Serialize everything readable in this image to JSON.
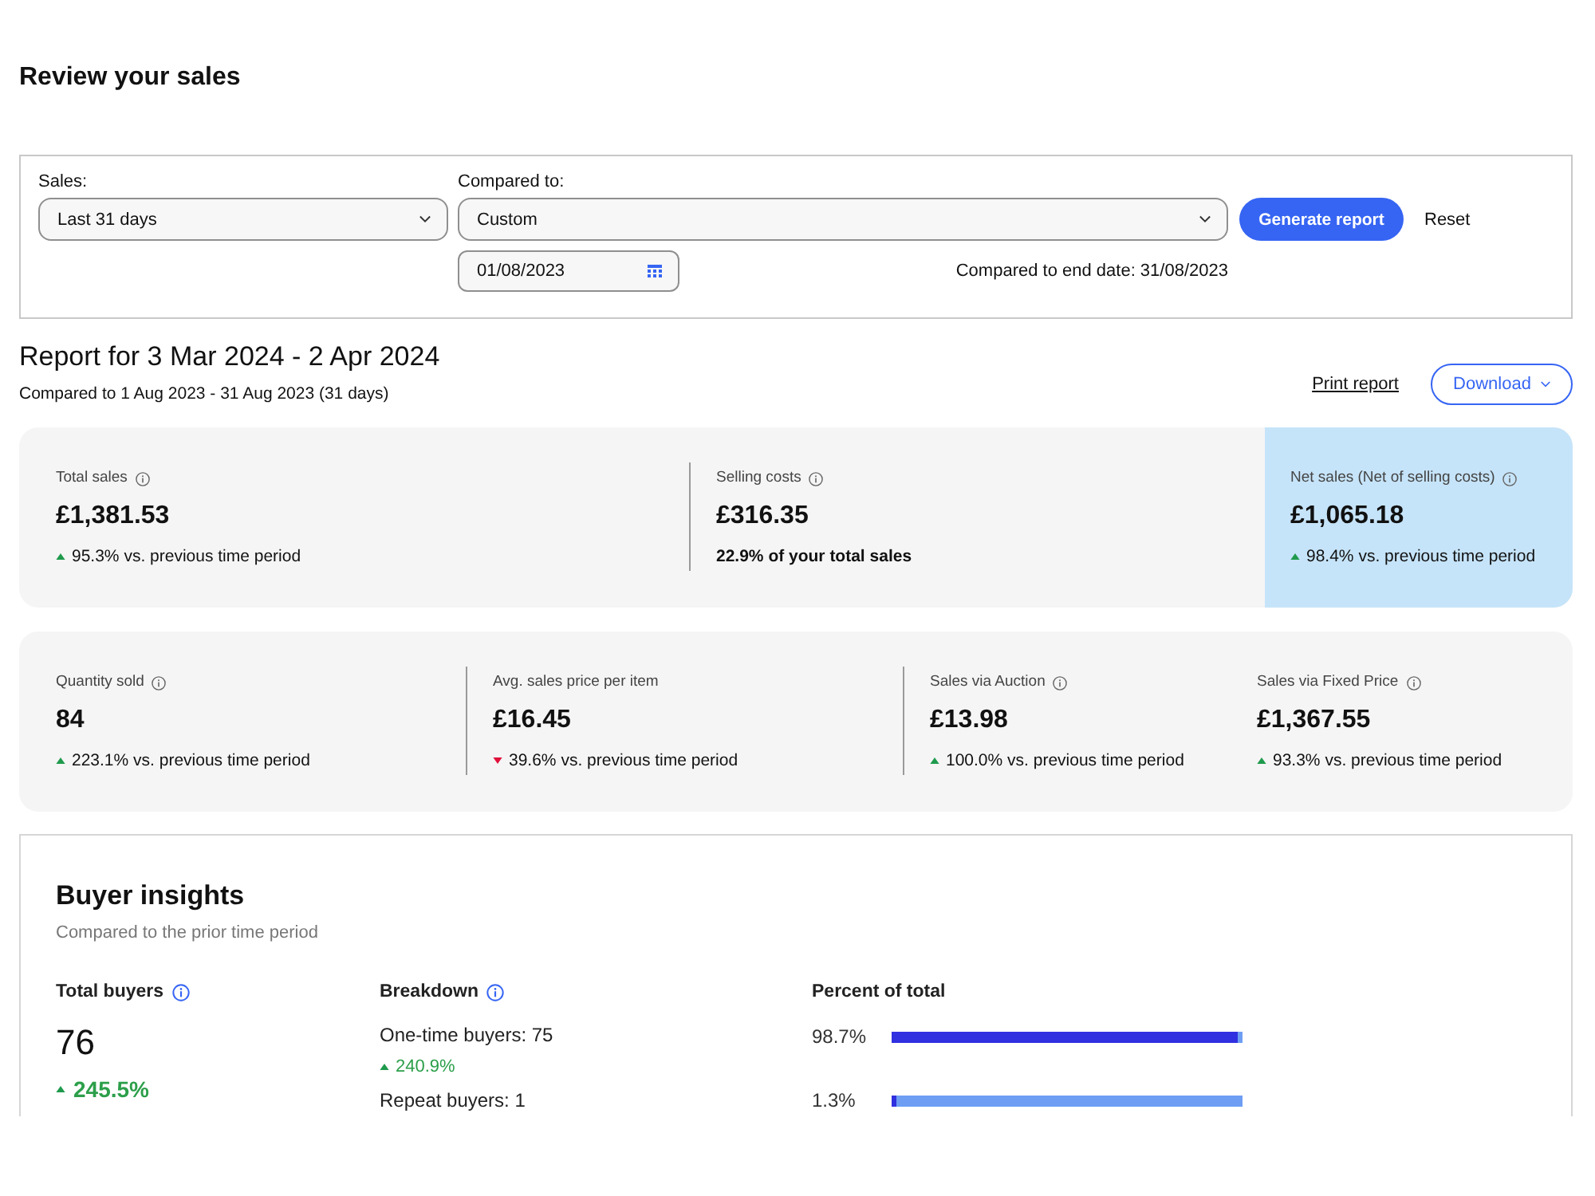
{
  "page": {
    "title": "Review your sales"
  },
  "filters": {
    "sales": {
      "label": "Sales:",
      "value": "Last 31 days"
    },
    "compared_to": {
      "label": "Compared to:",
      "value": "Custom"
    },
    "generate_button": "Generate report",
    "reset_button": "Reset",
    "start_date": {
      "value": "01/08/2023"
    },
    "end_date_note": "Compared to end date: 31/08/2023"
  },
  "report": {
    "title": "Report for 3 Mar 2024 - 2 Apr 2024",
    "subtitle": "Compared to 1 Aug 2023 - 31 Aug 2023 (31 days)",
    "print_link": "Print report",
    "download_button": "Download"
  },
  "summary_cards": [
    {
      "metrics": [
        {
          "label": "Total sales",
          "info": true,
          "highlighted": false,
          "value": "£1,381.53",
          "change": {
            "increase": true,
            "percent": "95.3%",
            "text": "vs. previous time period"
          }
        },
        {
          "label": "Selling costs",
          "info": true,
          "highlighted": false,
          "value": "£316.35",
          "note": "22.9% of your total sales"
        },
        {
          "label": "Net sales (Net of selling costs)",
          "info": true,
          "highlighted": true,
          "value": "£1,065.18",
          "change": {
            "increase": true,
            "percent": "98.4%",
            "text": "vs. previous time period"
          }
        }
      ]
    },
    {
      "metrics": [
        {
          "label": "Quantity sold",
          "info": true,
          "highlighted": false,
          "value": "84",
          "change": {
            "increase": true,
            "percent": "223.1%",
            "text": "vs. previous time period"
          }
        },
        {
          "label": "Avg. sales price per item",
          "info": false,
          "highlighted": false,
          "value": "£16.45",
          "change": {
            "increase": false,
            "percent": "39.6%",
            "text": "vs. previous time period"
          }
        },
        {
          "label": "Sales via Auction",
          "info": true,
          "highlighted": false,
          "value": "£13.98",
          "change": {
            "increase": true,
            "percent": "100.0%",
            "text": "vs. previous time period"
          }
        },
        {
          "label": "Sales via Fixed Price",
          "info": true,
          "highlighted": false,
          "value": "£1,367.55",
          "change": {
            "increase": true,
            "percent": "93.3%",
            "text": "vs. previous time period"
          }
        }
      ]
    }
  ],
  "buyer_insights": {
    "title": "Buyer insights",
    "subtitle": "Compared to the prior time period",
    "total_buyers": {
      "label": "Total buyers",
      "value": "76",
      "increase": true,
      "change": "245.5%"
    },
    "breakdown": {
      "label": "Breakdown",
      "items": [
        {
          "label": "One-time buyers: 75",
          "increase": true,
          "change": "240.9%"
        },
        {
          "label": "Repeat buyers: 1"
        }
      ]
    },
    "percent_of_total": {
      "label": "Percent of total",
      "rows": [
        {
          "reading": "98.7%",
          "level": 0.987
        },
        {
          "reading": "1.3%",
          "level": 0.013
        }
      ]
    }
  }
}
